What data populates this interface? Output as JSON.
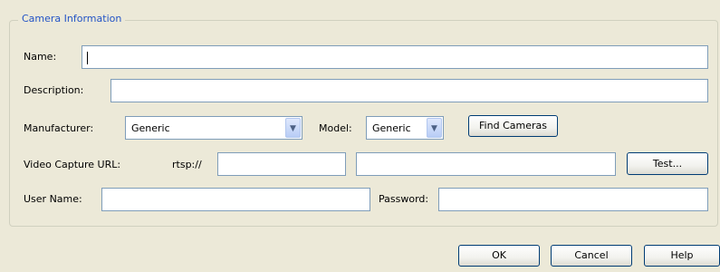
{
  "group": {
    "title": "Camera Information"
  },
  "form": {
    "name_label": "Name:",
    "name_value": "",
    "description_label": "Description:",
    "description_value": "",
    "manufacturer_label": "Manufacturer:",
    "manufacturer_value": "Generic",
    "model_label": "Model:",
    "model_value": "Generic",
    "find_cameras_label": "Find Cameras",
    "video_url_label": "Video Capture URL:",
    "url_prefix": "rtsp://",
    "url_host_value": "",
    "url_path_value": "",
    "test_label": "Test...",
    "username_label": "User Name:",
    "username_value": "",
    "password_label": "Password:",
    "password_value": ""
  },
  "footer": {
    "ok_label": "OK",
    "cancel_label": "Cancel",
    "help_label": "Help"
  },
  "icons": {
    "dropdown": "chevron-down-icon"
  },
  "colors": {
    "accent": "#2354c6",
    "background": "#ece9d8",
    "field_border": "#7f9db9"
  }
}
